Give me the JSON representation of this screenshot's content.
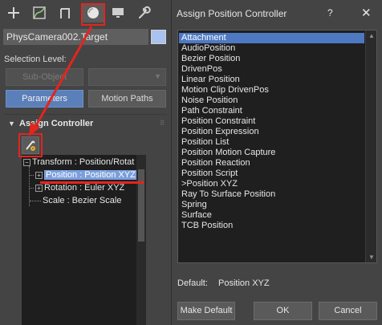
{
  "command_panel": {
    "tabs": [
      {
        "name": "create",
        "icon": "plus-icon"
      },
      {
        "name": "modify",
        "icon": "modify-curve-icon"
      },
      {
        "name": "hierarchy",
        "icon": "hierarchy-icon"
      },
      {
        "name": "motion",
        "icon": "motion-icon",
        "active": true
      },
      {
        "name": "display",
        "icon": "display-monitor-icon"
      },
      {
        "name": "utilities",
        "icon": "wrench-icon"
      }
    ],
    "object_name": "PhysCamera002.Target",
    "object_color": "#a9c2ef",
    "selection_level_label": "Selection Level:",
    "sub_object_label": "Sub-Object",
    "parameters_label": "Parameters",
    "motion_paths_label": "Motion Paths",
    "rollout_title": "Assign Controller",
    "tree": {
      "transform": "Transform : Position/Rotat",
      "position": "Position : Position XYZ",
      "rotation": "Rotation : Euler XYZ",
      "scale": "Scale : Bezier Scale"
    }
  },
  "dialog": {
    "title": "Assign Position Controller",
    "help_label": "?",
    "close_label": "✕",
    "controllers": [
      "Attachment",
      "AudioPosition",
      "Bezier Position",
      "DrivenPos",
      "Linear Position",
      "Motion Clip DrivenPos",
      "Noise Position",
      "Path Constraint",
      "Position Constraint",
      "Position Expression",
      "Position List",
      "Position Motion Capture",
      "Position Reaction",
      "Position Script",
      ">Position XYZ",
      "Ray To Surface Position",
      "Spring",
      "Surface",
      "TCB Position"
    ],
    "selected_index": 0,
    "default_label": "Default:",
    "default_value": "Position XYZ",
    "make_default_label": "Make Default",
    "ok_label": "OK",
    "cancel_label": "Cancel"
  },
  "colors": {
    "panel_bg": "#444444",
    "list_bg": "#1f1f1f",
    "selection_blue": "#4e79c2",
    "parameters_blue": "#5b7fb8",
    "annotation_red": "#e2251f"
  }
}
